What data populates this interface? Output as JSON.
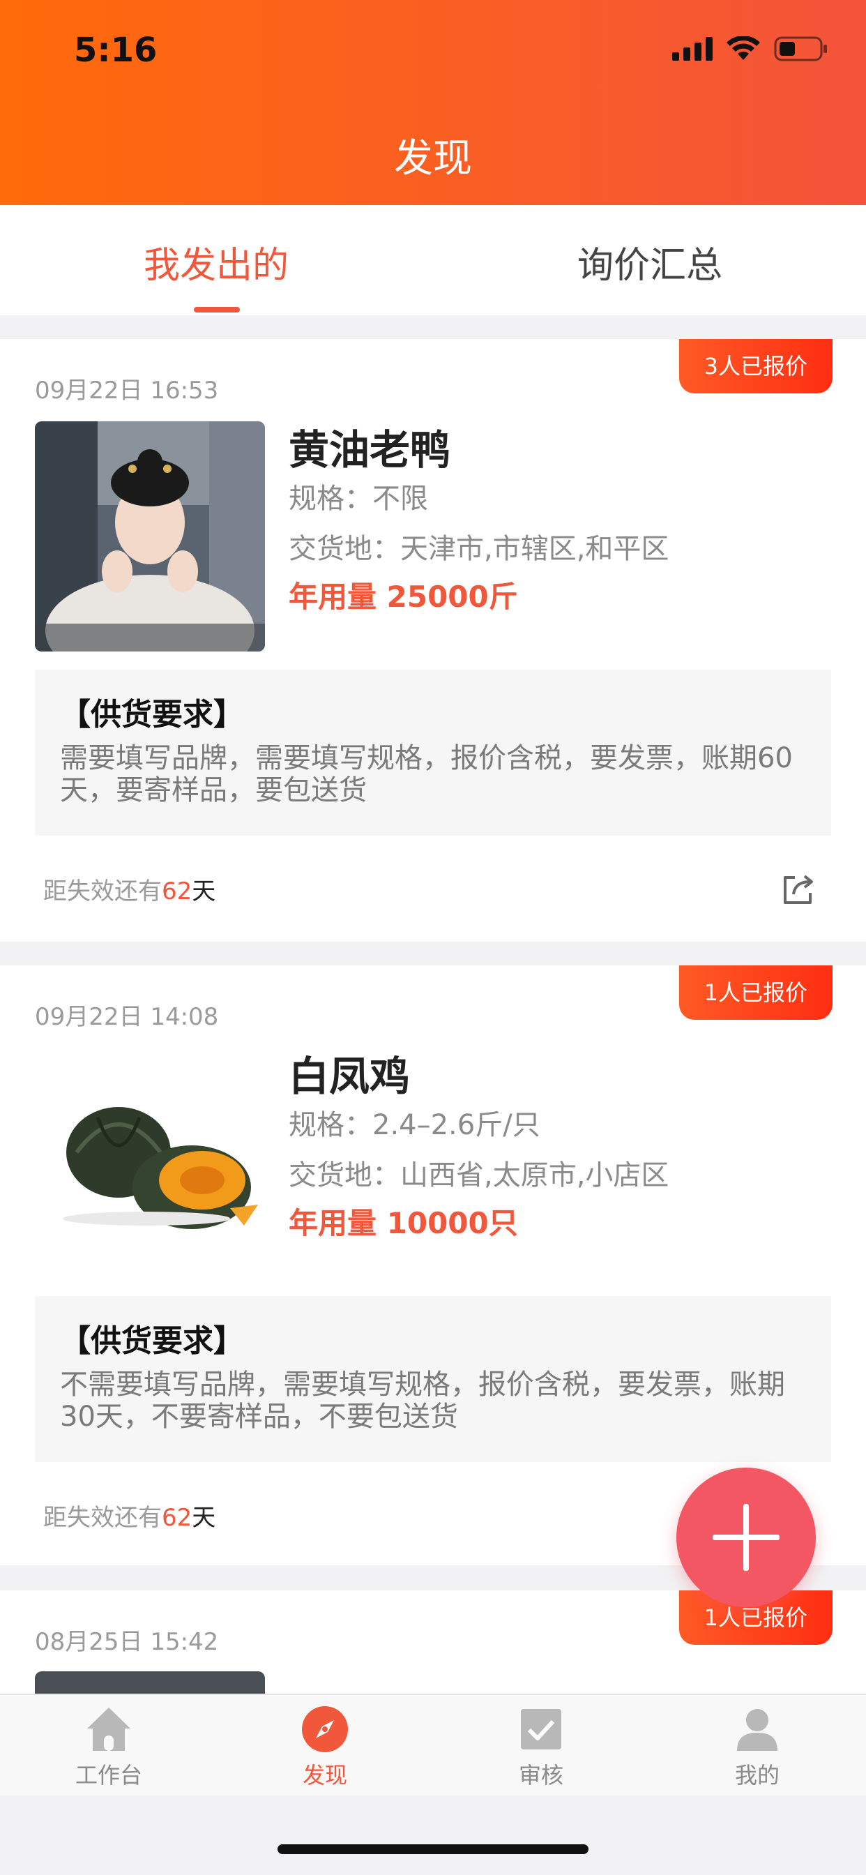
{
  "status": {
    "time": "5:16"
  },
  "header": {
    "title": "发现"
  },
  "tabs": [
    {
      "label": "我发出的",
      "active": true
    },
    {
      "label": "询价汇总",
      "active": false
    }
  ],
  "cards": [
    {
      "badge": "3人已报价",
      "datetime": "09月22日 16:53",
      "name": "黄油老鸭",
      "spec": "规格：不限",
      "place": "交货地：天津市,市辖区,和平区",
      "usage": "年用量 25000斤",
      "req_title": "【供货要求】",
      "req_text": "需要填写品牌，需要填写规格，报价含税，要发票，账期60天，要寄样品，要包送货",
      "expire_prefix": "距失效还有",
      "expire_days": "62",
      "expire_unit": "天",
      "image": "woman-photo"
    },
    {
      "badge": "1人已报价",
      "datetime": "09月22日 14:08",
      "name": "白凤鸡",
      "spec": "规格：2.4–2.6斤/只",
      "place": "交货地：山西省,太原市,小店区",
      "usage": "年用量 10000只",
      "req_title": "【供货要求】",
      "req_text": "不需要填写品牌，需要填写规格，报价含税，要发票，账期30天，不要寄样品，不要包送货",
      "expire_prefix": "距失效还有",
      "expire_days": "62",
      "expire_unit": "天",
      "image": "pumpkin-photo"
    },
    {
      "badge": "1人已报价",
      "datetime": "08月25日 15:42"
    }
  ],
  "fab": {
    "icon": "plus-icon"
  },
  "bottom_nav": [
    {
      "label": "工作台",
      "icon": "home-icon",
      "active": false
    },
    {
      "label": "发现",
      "icon": "compass-icon",
      "active": true
    },
    {
      "label": "审核",
      "icon": "check-box-icon",
      "active": false
    },
    {
      "label": "我的",
      "icon": "user-icon",
      "active": false
    }
  ],
  "colors": {
    "accent": "#f0573b",
    "header_start": "#ff6a0a",
    "header_end": "#f4543a",
    "fab": "#f25763"
  }
}
